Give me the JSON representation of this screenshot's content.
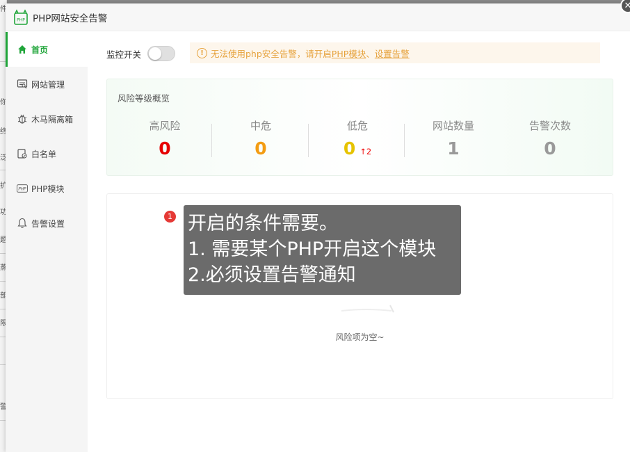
{
  "window": {
    "title": "PHP网站安全告警",
    "close_icon": "close-icon"
  },
  "background_fragments": [
    "件",
    "你",
    "终",
    "泛",
    "扩",
    "功",
    "题",
    "蒸",
    "部",
    "限",
    "警"
  ],
  "sidebar": {
    "items": [
      {
        "label": "首页",
        "icon": "home-icon",
        "active": true
      },
      {
        "label": "网站管理",
        "icon": "website-icon",
        "active": false
      },
      {
        "label": "木马隔离箱",
        "icon": "quarantine-icon",
        "active": false
      },
      {
        "label": "白名单",
        "icon": "whitelist-icon",
        "active": false
      },
      {
        "label": "PHP模块",
        "icon": "php-icon",
        "active": false
      },
      {
        "label": "告警设置",
        "icon": "bell-icon",
        "active": false
      }
    ]
  },
  "monitor": {
    "label": "监控开关",
    "enabled": false
  },
  "warning": {
    "icon_glyph": "!",
    "text_before": "无法使用php安全告警，请开启",
    "link1": "PHP模块",
    "separator": "、",
    "link2": "设置告警"
  },
  "risk_overview": {
    "title": "风险等级概览",
    "stats": [
      {
        "label": "高风险",
        "value": "0",
        "color": "#e60000"
      },
      {
        "label": "中危",
        "value": "0",
        "color": "#f39c12"
      },
      {
        "label": "低危",
        "value": "0",
        "color": "#e6c300",
        "extra": "↑2"
      },
      {
        "label": "网站数量",
        "value": "1",
        "color": "#999999"
      },
      {
        "label": "告警次数",
        "value": "0",
        "color": "#999999"
      }
    ]
  },
  "list": {
    "empty_text": "风险项为空~"
  },
  "annotation": {
    "badge": "1",
    "lines": [
      "开启的条件需要。",
      "1. 需要某个PHP开启这个模块",
      "2.必须设置告警通知"
    ]
  },
  "colors": {
    "accent": "#20a53a",
    "warning": "#e6a23c"
  }
}
